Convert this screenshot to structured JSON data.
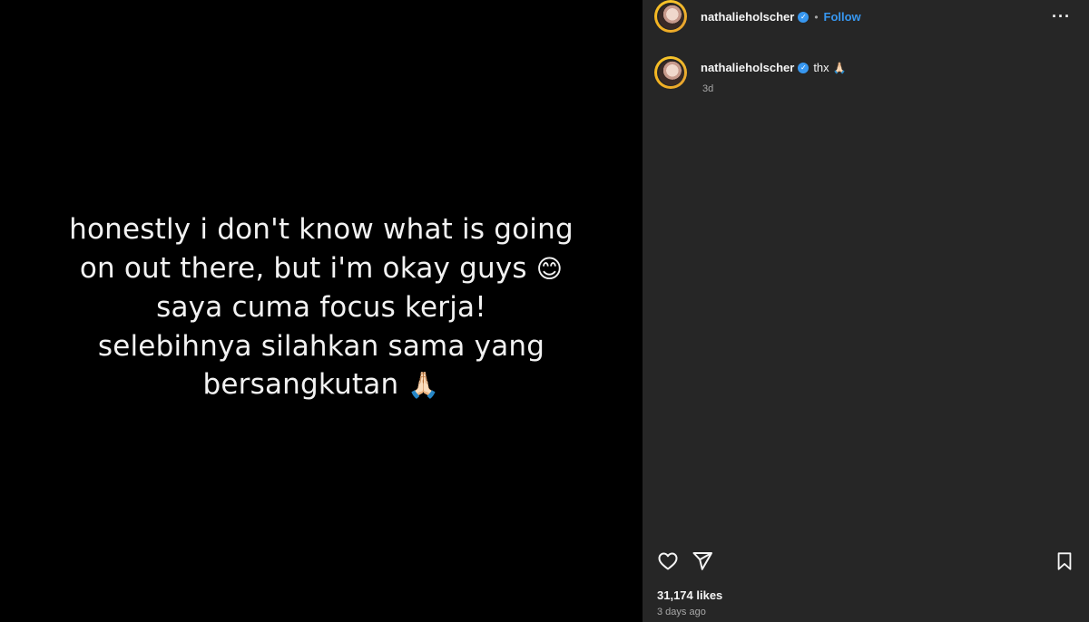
{
  "story": {
    "lines": [
      "honestly i don't know what is going",
      "on out there, but i'm okay guys",
      "saya cuma focus kerja!",
      "selebihnya silahkan sama yang",
      "bersangkutan"
    ],
    "emoji_smile": "😊",
    "emoji_pray": "🙏🏻"
  },
  "header": {
    "username": "nathalieholscher",
    "verified_mark": "✓",
    "separator": "•",
    "follow_label": "Follow",
    "more_label": "···"
  },
  "comment": {
    "username": "nathalieholscher",
    "verified_mark": "✓",
    "text": "thx",
    "emoji": "🙏🏻",
    "time": "3d"
  },
  "footer": {
    "likes": "31,174 likes",
    "time": "3 days ago"
  },
  "icons": {
    "like": "heart-icon",
    "share": "paper-plane-icon",
    "save": "bookmark-icon",
    "more": "more-options-icon",
    "verified": "verified-badge-icon"
  },
  "colors": {
    "accent_link": "#3797f0",
    "panel_bg": "#262626",
    "media_bg": "#000000",
    "muted_text": "#a8a8a8"
  }
}
